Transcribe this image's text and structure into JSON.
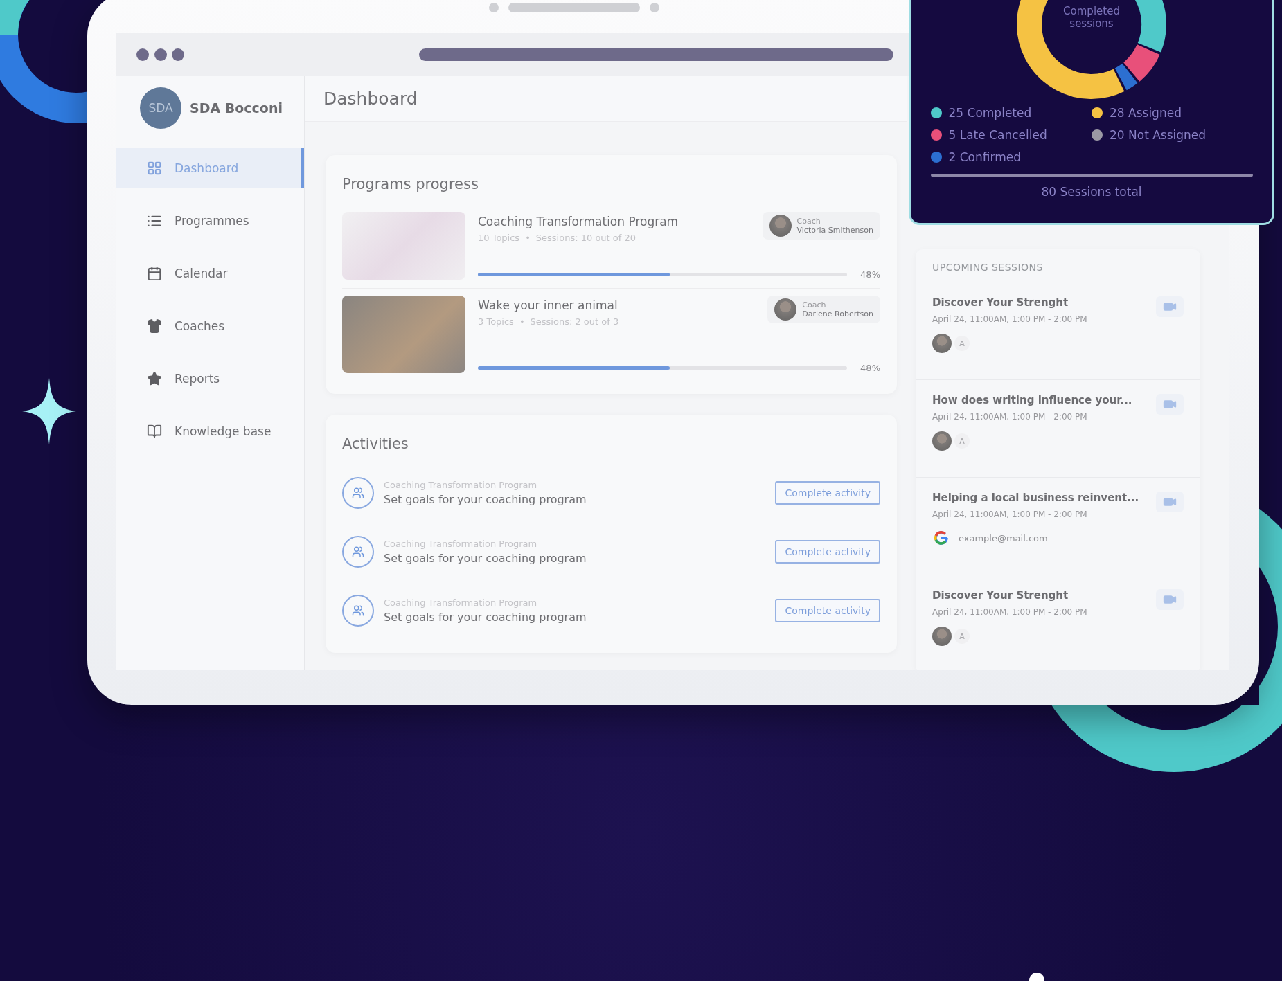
{
  "app": {
    "org_logo": "SDA",
    "org_name": "SDA Bocconi"
  },
  "nav": [
    {
      "label": "Dashboard",
      "selected": true
    },
    {
      "label": "Programmes",
      "selected": false
    },
    {
      "label": "Calendar",
      "selected": false
    },
    {
      "label": "Coaches",
      "selected": false
    },
    {
      "label": "Reports",
      "selected": false
    },
    {
      "label": "Knowledge base",
      "selected": false
    }
  ],
  "page_title": "Dashboard",
  "programs": {
    "title": "Programs progress",
    "items": [
      {
        "title": "Coaching Transformation Program",
        "topics": "10 Topics",
        "separator": "•",
        "sessions": "Sessions: 10 out of 20",
        "coach_label": "Coach",
        "coach_name": "Victoria Smithenson",
        "level": 0.52,
        "percent": "48%"
      },
      {
        "title": "Wake your inner animal",
        "topics": "3 Topics",
        "separator": "•",
        "sessions": "Sessions: 2 out of 3",
        "coach_label": "Coach",
        "coach_name": "Darlene Robertson",
        "level": 0.52,
        "percent": "48%"
      }
    ]
  },
  "activities": {
    "title": "Activities",
    "items": [
      {
        "program": "Coaching Transformation Program",
        "task": "Set goals for your coaching program",
        "action": "Complete activity"
      },
      {
        "program": "Coaching Transformation Program",
        "task": "Set goals for your coaching program",
        "action": "Complete activity"
      },
      {
        "program": "Coaching Transformation Program",
        "task": "Set goals for your coaching program",
        "action": "Complete activity"
      }
    ]
  },
  "upcoming": {
    "title": "UPCOMING SESSIONS",
    "items": [
      {
        "title": "Discover Your Strenght",
        "time": "April 24, 11:00AM, 1:00 PM - 2:00 PM",
        "kind": "avatar",
        "attendee": "A"
      },
      {
        "title": "How does writing influence your...",
        "time": "April 24, 11:00AM, 1:00 PM - 2:00 PM",
        "kind": "avatar",
        "attendee": "A"
      },
      {
        "title": "Helping a local business reinvent...",
        "time": "April 24, 11:00AM, 1:00 PM - 2:00 PM",
        "kind": "google",
        "attendee": "example@mail.com"
      },
      {
        "title": "Discover Your Strenght",
        "time": "April 24, 11:00AM, 1:00 PM - 2:00 PM",
        "kind": "avatar",
        "attendee": "A"
      }
    ]
  },
  "stats": {
    "center_label": "Completed sessions",
    "legend": [
      {
        "label": "25 Completed",
        "color": "#4fc9c9"
      },
      {
        "label": "28 Assigned",
        "color": "#f5c243"
      },
      {
        "label": "5 Late Cancelled",
        "color": "#e8507a"
      },
      {
        "label": "20 Not Assigned",
        "color": "#9a98a4"
      },
      {
        "label": "2 Confirmed",
        "color": "#2c6fd1"
      }
    ],
    "total": "80 Sessions total"
  }
}
